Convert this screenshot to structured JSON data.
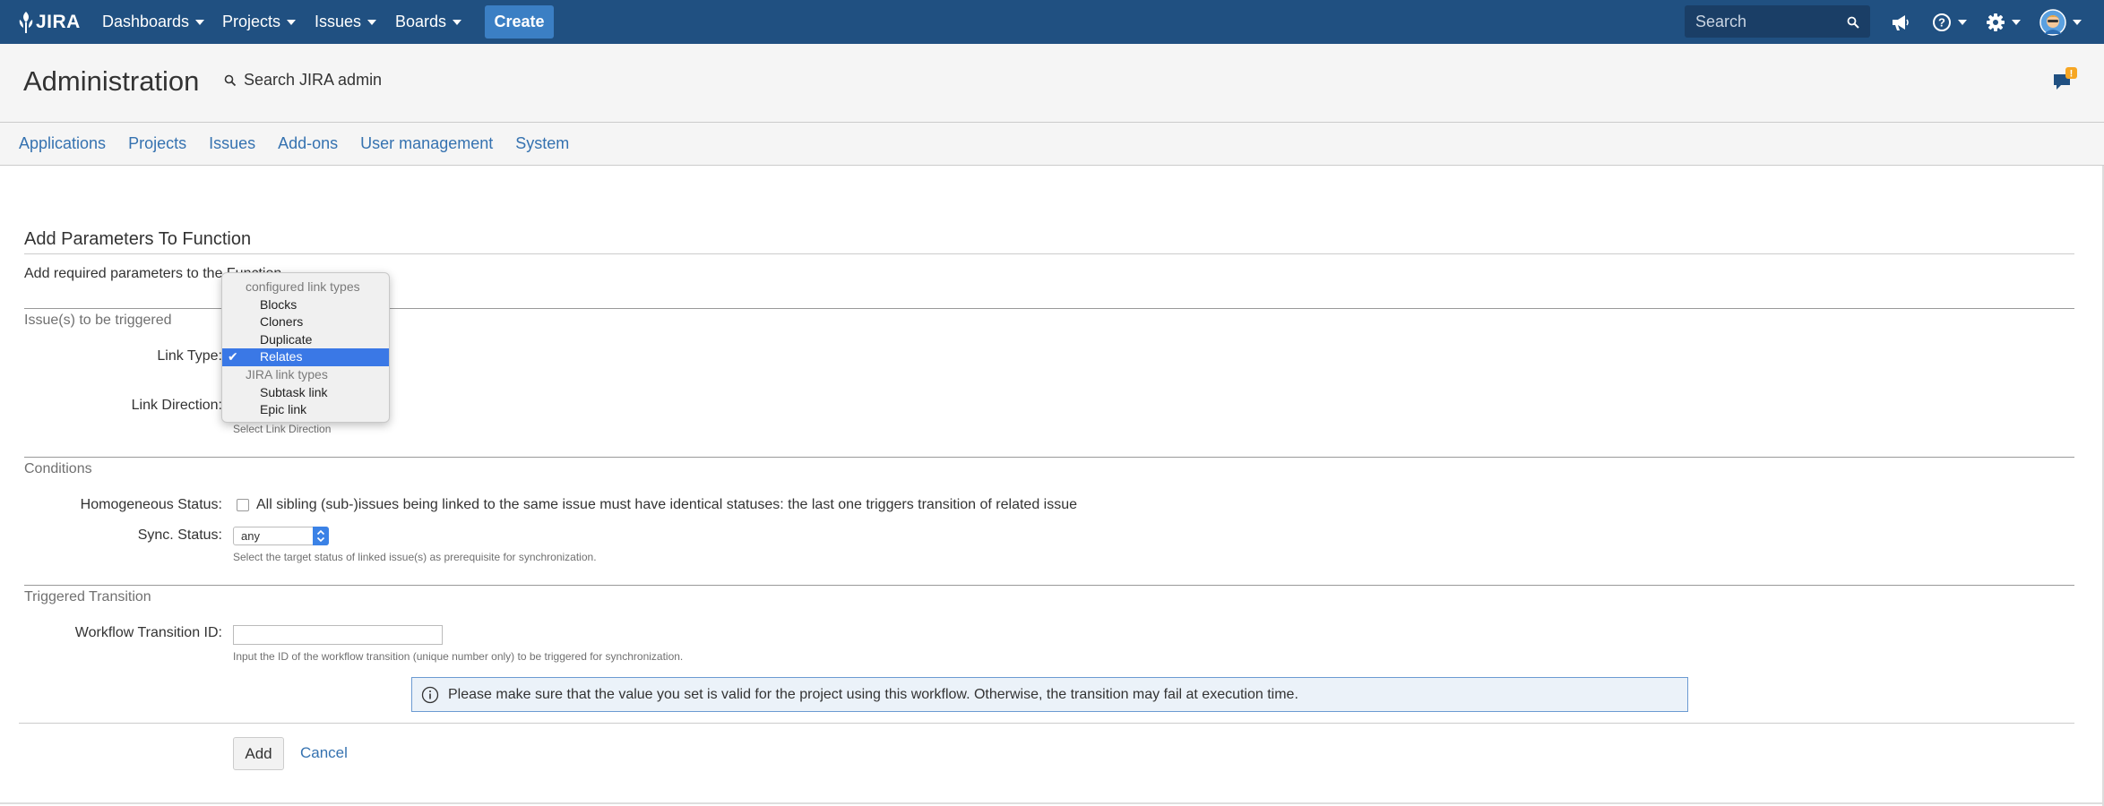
{
  "topbar": {
    "logo": "JIRA",
    "nav": [
      {
        "label": "Dashboards"
      },
      {
        "label": "Projects"
      },
      {
        "label": "Issues"
      },
      {
        "label": "Boards"
      }
    ],
    "create_label": "Create",
    "search_placeholder": "Search",
    "icons": [
      "megaphone-icon",
      "help-icon",
      "gear-icon",
      "avatar"
    ]
  },
  "admin": {
    "title": "Administration",
    "search_label": "Search JIRA admin",
    "feedback_badge": "!"
  },
  "admin_nav": [
    "Applications",
    "Projects",
    "Issues",
    "Add-ons",
    "User management",
    "System"
  ],
  "form": {
    "heading": "Add Parameters To Function",
    "description": "Add required parameters to the Function.",
    "sections": {
      "issues": "Issue(s) to be triggered",
      "conditions": "Conditions",
      "transition": "Triggered Transition"
    },
    "link_type_label": "Link Type:",
    "link_direction_label": "Link Direction:",
    "link_direction_hint": "Select Link Direction",
    "homogeneous_label": "Homogeneous Status:",
    "homogeneous_text": "All sibling (sub-)issues being linked to the same issue must have identical statuses: the last one triggers transition of related issue",
    "sync_label": "Sync. Status:",
    "sync_value": "any",
    "sync_hint": "Select the target status of linked issue(s) as prerequisite for synchronization.",
    "transition_label": "Workflow Transition ID:",
    "transition_value": "",
    "transition_hint": "Input the ID of the workflow transition (unique number only) to be triggered for synchronization.",
    "info_message": "Please make sure that the value you set is valid for the project using this workflow. Otherwise, the transition may fail at execution time.",
    "add_label": "Add",
    "cancel_label": "Cancel"
  },
  "dropdown": {
    "groups": [
      {
        "label": "configured link types",
        "items": [
          "Blocks",
          "Cloners",
          "Duplicate",
          "Relates"
        ]
      },
      {
        "label": "JIRA link types",
        "items": [
          "Subtask link",
          "Epic link"
        ]
      }
    ],
    "selected": "Relates",
    "selected_color": "#3a78e6"
  },
  "colors": {
    "header_bg": "#205081",
    "create_bg": "#3b7fc4",
    "link": "#3572b0"
  }
}
